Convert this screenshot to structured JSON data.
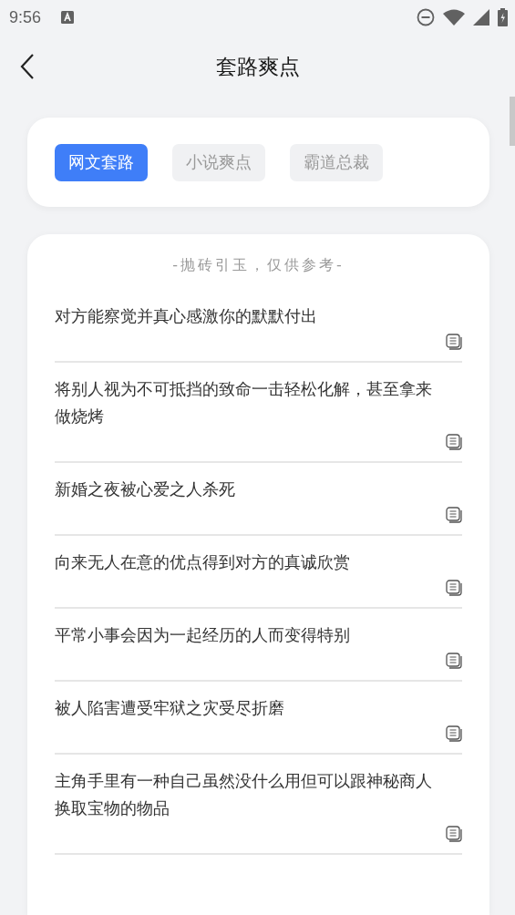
{
  "status_bar": {
    "time": "9:56"
  },
  "header": {
    "title": "套路爽点"
  },
  "tabs": [
    {
      "label": "网文套路",
      "selected": true
    },
    {
      "label": "小说爽点",
      "selected": false
    },
    {
      "label": "霸道总裁",
      "selected": false
    }
  ],
  "list": {
    "heading": "-抛砖引玉，仅供参考-",
    "items": [
      {
        "text": "对方能察觉并真心感激你的默默付出"
      },
      {
        "text": "将别人视为不可抵挡的致命一击轻松化解，甚至拿来做烧烤"
      },
      {
        "text": "新婚之夜被心爱之人杀死"
      },
      {
        "text": "向来无人在意的优点得到对方的真诚欣赏"
      },
      {
        "text": "平常小事会因为一起经历的人而变得特别"
      },
      {
        "text": "被人陷害遭受牢狱之灾受尽折磨"
      },
      {
        "text": "主角手里有一种自己虽然没什么用但可以跟神秘商人换取宝物的物品"
      }
    ]
  }
}
